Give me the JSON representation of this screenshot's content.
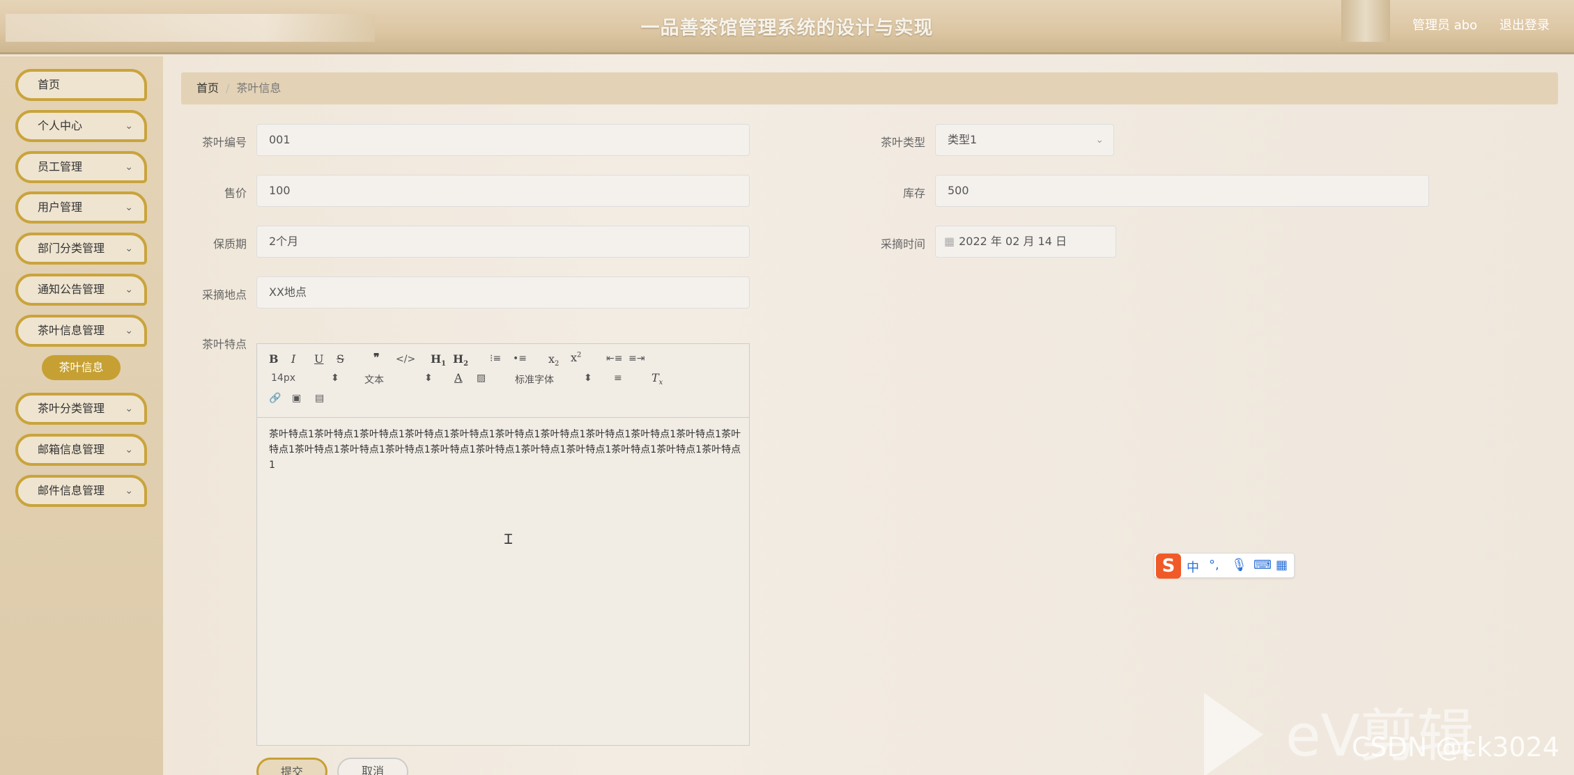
{
  "header": {
    "title": "一品善茶馆管理系统的设计与实现",
    "user": "管理员 abo",
    "logout": "退出登录"
  },
  "sidebar": {
    "items": [
      {
        "label": "首页"
      },
      {
        "label": "个人中心"
      },
      {
        "label": "员工管理"
      },
      {
        "label": "用户管理"
      },
      {
        "label": "部门分类管理"
      },
      {
        "label": "通知公告管理"
      },
      {
        "label": "茶叶信息管理"
      },
      {
        "label": "茶叶分类管理"
      },
      {
        "label": "邮箱信息管理"
      },
      {
        "label": "邮件信息管理"
      }
    ],
    "active_sub": "茶叶信息"
  },
  "breadcrumb": {
    "home": "首页",
    "current": "茶叶信息"
  },
  "form": {
    "tea_no": {
      "label": "茶叶编号",
      "value": "001"
    },
    "tea_type": {
      "label": "茶叶类型",
      "value": "类型1"
    },
    "price": {
      "label": "售价",
      "value": "100"
    },
    "stock": {
      "label": "库存",
      "value": "500"
    },
    "shelf_life": {
      "label": "保质期",
      "value": "2个月"
    },
    "pick_time": {
      "label": "采摘时间",
      "value": "2022 年 02 月 14 日"
    },
    "pick_place": {
      "label": "采摘地点",
      "value": "XX地点"
    },
    "feature": {
      "label": "茶叶特点"
    }
  },
  "editor": {
    "font_size": "14px",
    "text_type": "文本",
    "font_family": "标准字体",
    "content": "茶叶特点1茶叶特点1茶叶特点1茶叶特点1茶叶特点1茶叶特点1茶叶特点1茶叶特点1茶叶特点1茶叶特点1茶叶特点1茶叶特点1茶叶特点1茶叶特点1茶叶特点1茶叶特点1茶叶特点1茶叶特点1茶叶特点1茶叶特点1茶叶特点1"
  },
  "buttons": {
    "submit": "提交",
    "cancel": "取消"
  },
  "ime": {
    "mode": "中"
  },
  "watermark": {
    "brand": "eV剪辑",
    "csdn": "CSDN @ck3024"
  }
}
